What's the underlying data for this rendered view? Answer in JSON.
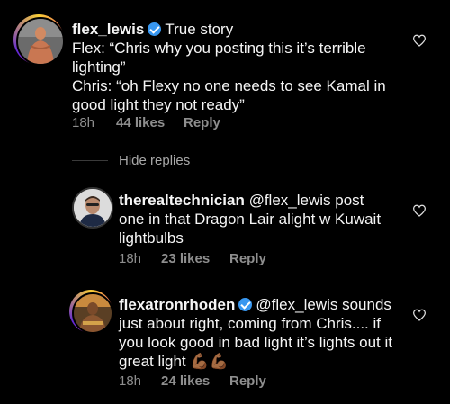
{
  "comments": [
    {
      "username": "flex_lewis",
      "verified": true,
      "text_lines": [
        "True story",
        "Flex: “Chris why you posting this it’s terrible",
        "lighting”",
        "Chris: “oh Flexy no one needs to see Kamal in",
        "good light they not ready”"
      ],
      "time": "18h",
      "likes": "44 likes",
      "reply": "Reply"
    },
    {
      "username": "therealtechnician",
      "verified": false,
      "text_lines": [
        "@flex_lewis post",
        "one in that Dragon Lair alight w Kuwait",
        "lightbulbs"
      ],
      "time": "18h",
      "likes": "23 likes",
      "reply": "Reply"
    },
    {
      "username": "flexatronrhoden",
      "verified": true,
      "text_lines": [
        "@flex_lewis sounds",
        "just about right, coming from Chris.... if",
        "you look good in bad light it’s lights out it",
        "great light 💪🏾💪🏾"
      ],
      "time": "18h",
      "likes": "24 likes",
      "reply": "Reply"
    }
  ],
  "hide_replies": "Hide replies",
  "colors": {
    "background": "#000000",
    "text": "#f5f5f5",
    "meta": "#8e8e8e",
    "verified": "#3897f0"
  }
}
